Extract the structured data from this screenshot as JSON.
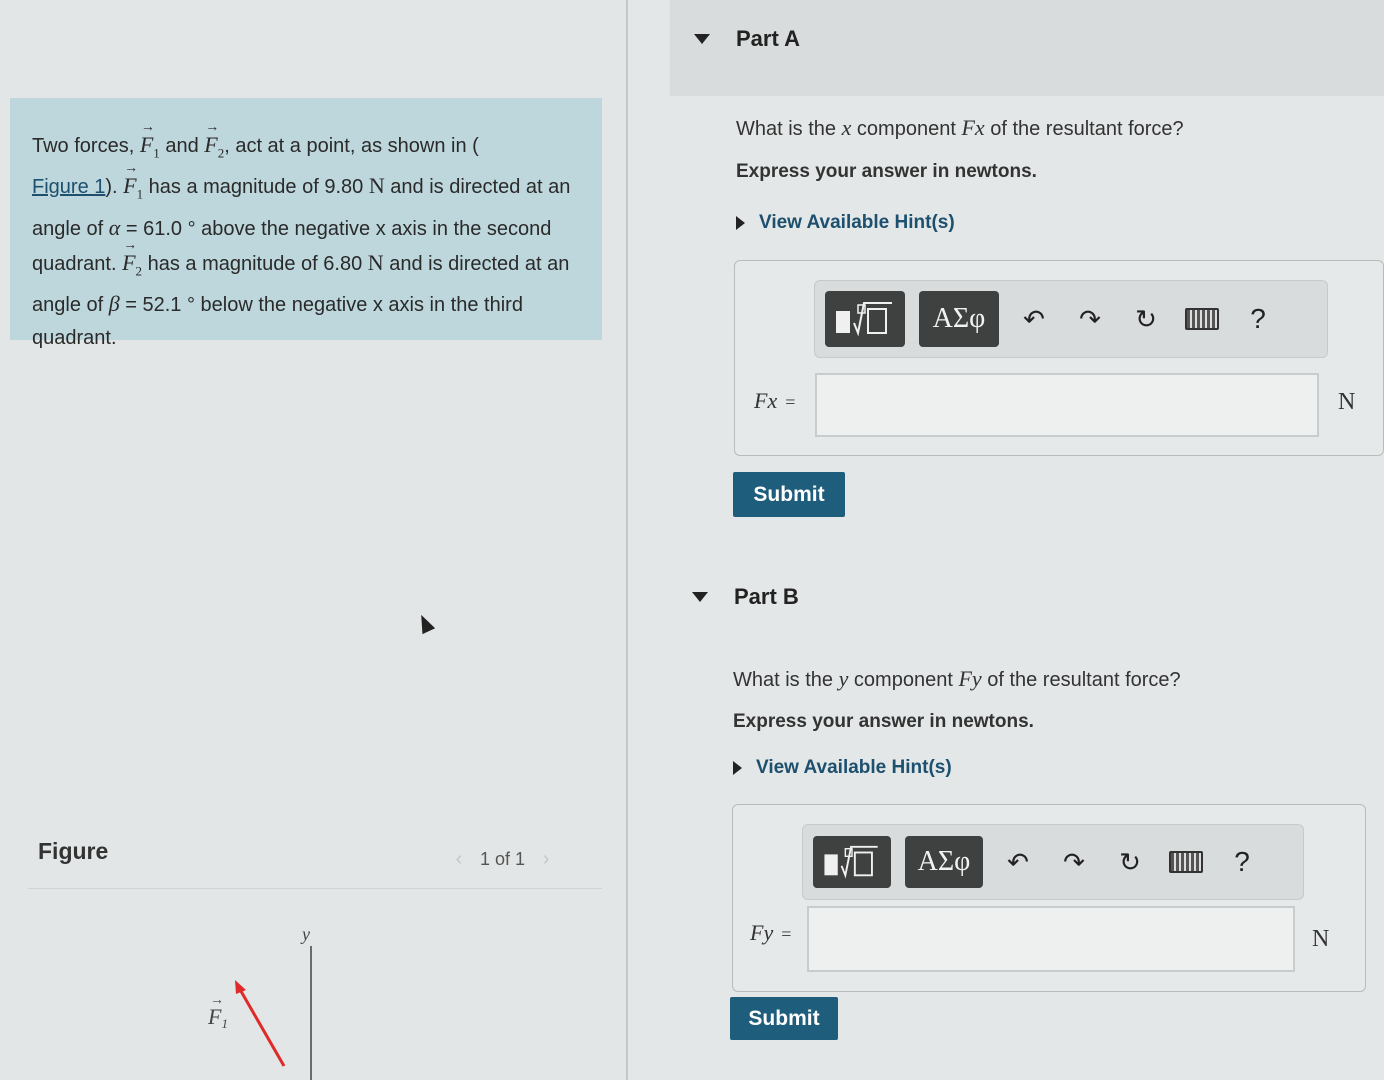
{
  "problem": {
    "text_1": "Two forces, ",
    "f1_sym": "F",
    "f1_sub": "1",
    "text_and": " and ",
    "f2_sym": "F",
    "f2_sub": "2",
    "text_2": ", act at a point, as shown in (",
    "figure_link": "Figure 1",
    "text_3": "). ",
    "text_4": " has a magnitude of 9.80 ",
    "unit_N": "N",
    "text_5": " and is directed at an angle of ",
    "alpha": "α",
    "text_6": " = 61.0 ° above the negative x axis in the second quadrant. ",
    "text_7": " has a magnitude of 6.80 ",
    "text_8": " and is directed at an angle of ",
    "beta": "β",
    "text_9": " = 52.1 ° below the negative x axis in the third quadrant."
  },
  "figure": {
    "title": "Figure",
    "pager_text": "1 of 1",
    "prev_icon": "chevron-left-icon",
    "next_icon": "chevron-right-icon",
    "axis_y_label": "y",
    "vector_label": "F",
    "vector_sub": "1",
    "vector_color": "#e02a2a"
  },
  "part_a": {
    "label": "Part A",
    "question_1": "What is the ",
    "question_var": "x",
    "question_2": " component ",
    "question_sym": "Fx",
    "question_3": " of the resultant force?",
    "instruction": "Express your answer in newtons.",
    "hint": "View Available Hint(s)",
    "var_label": "Fx",
    "eq": "=",
    "input_value": "",
    "unit": "N",
    "submit": "Submit"
  },
  "part_b": {
    "label": "Part B",
    "question_1": "What is the ",
    "question_var": "y",
    "question_2": " component ",
    "question_sym": "Fy",
    "question_3": " of the resultant force?",
    "instruction": "Express your answer in newtons.",
    "hint": "View Available Hint(s)",
    "var_label": "Fy",
    "eq": "=",
    "input_value": "",
    "unit": "N",
    "submit": "Submit"
  },
  "toolbar": {
    "greek_label": "ΑΣφ",
    "undo_icon": "undo-icon",
    "redo_icon": "redo-icon",
    "reset_icon": "reset-icon",
    "keyboard_icon": "keyboard-icon",
    "help_label": "?"
  },
  "colors": {
    "problem_bg": "#bdd7dc",
    "submit_bg": "#1f5d7d",
    "link": "#1d4f6e"
  }
}
